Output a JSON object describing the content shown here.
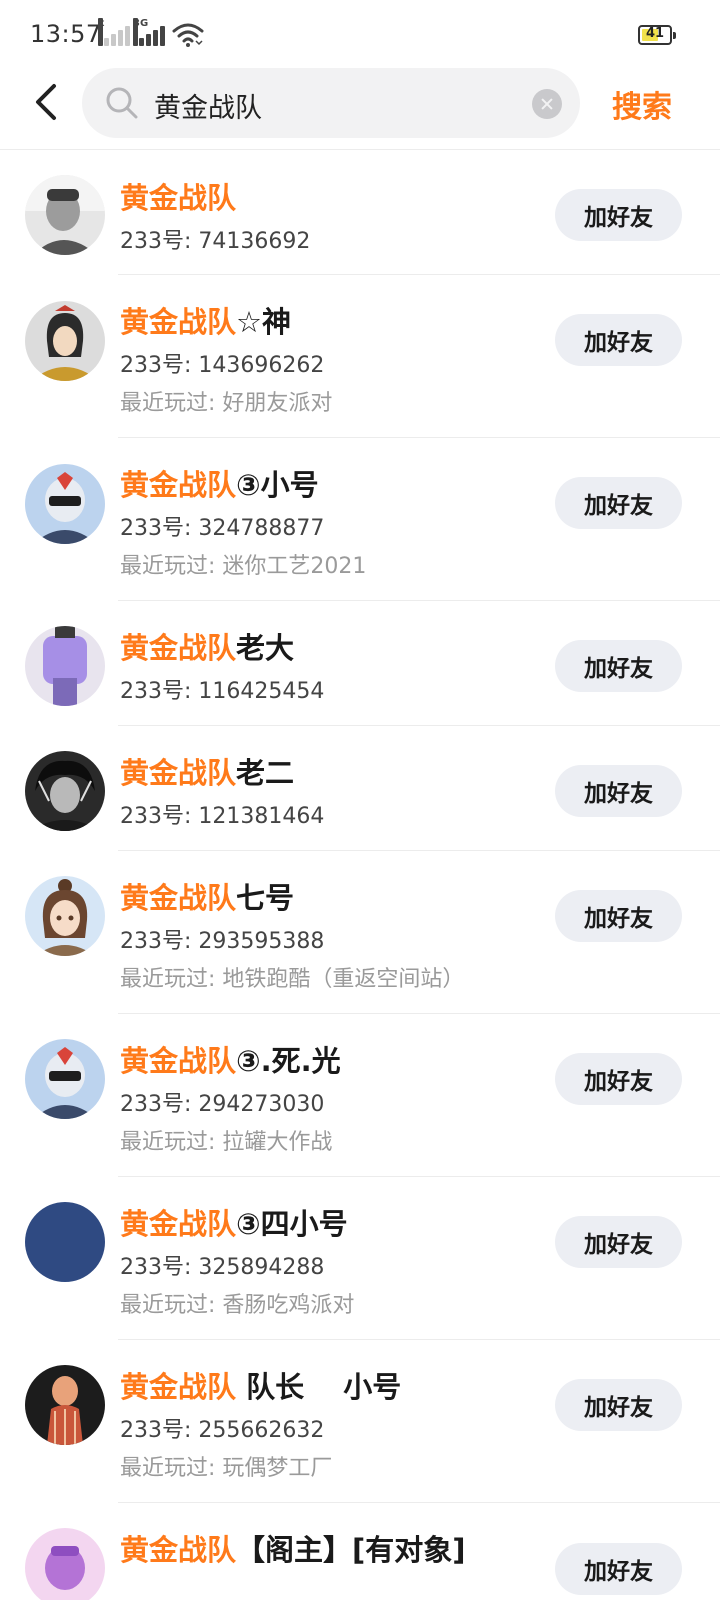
{
  "status_bar": {
    "time": "13:57",
    "signal_1_tag": "x",
    "signal_2_tag": "3G",
    "battery": "41"
  },
  "header": {
    "search_query": "黄金战队",
    "search_button": "搜索"
  },
  "colors": {
    "accent": "#ff7a1a",
    "button_bg": "#eceef3"
  },
  "results": [
    {
      "name_match": "黄金战队",
      "name_rest": "",
      "id": "233号: 74136692",
      "recent": "",
      "button": "加好友"
    },
    {
      "name_match": "黄金战队",
      "name_rest": "☆神",
      "id": "233号: 143696262",
      "recent": "最近玩过: 好朋友派对",
      "button": "加好友"
    },
    {
      "name_match": "黄金战队",
      "name_rest": "③小号",
      "id": "233号: 324788877",
      "recent": "最近玩过: 迷你工艺2021",
      "button": "加好友"
    },
    {
      "name_match": "黄金战队",
      "name_rest": "老大",
      "id": "233号: 116425454",
      "recent": "",
      "button": "加好友"
    },
    {
      "name_match": "黄金战队",
      "name_rest": "老二",
      "id": "233号: 121381464",
      "recent": "",
      "button": "加好友"
    },
    {
      "name_match": "黄金战队",
      "name_rest": "七号",
      "id": "233号: 293595388",
      "recent": "最近玩过: 地铁跑酷（重返空间站）",
      "button": "加好友"
    },
    {
      "name_match": "黄金战队",
      "name_rest": "③.死.光",
      "id": "233号: 294273030",
      "recent": "最近玩过: 拉罐大作战",
      "button": "加好友"
    },
    {
      "name_match": "黄金战队",
      "name_rest": "③四小号",
      "id": "233号: 325894288",
      "recent": "最近玩过: 香肠吃鸡派对",
      "button": "加好友"
    },
    {
      "name_match": "黄金战队",
      "name_rest": " 队长　 小号",
      "id": "233号: 255662632",
      "recent": "最近玩过: 玩偶梦工厂",
      "button": "加好友"
    },
    {
      "name_match": "黄金战队",
      "name_rest": "【阁主】[有对象]",
      "id": "",
      "recent": "",
      "button": "加好友"
    }
  ]
}
